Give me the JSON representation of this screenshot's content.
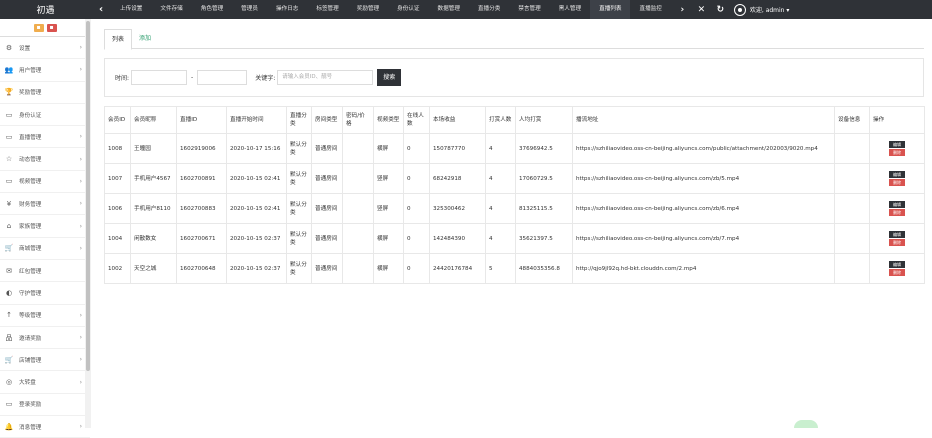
{
  "app": {
    "logo": "初遇"
  },
  "topnav": {
    "items": [
      "上传设置",
      "文件存储",
      "角色管理",
      "管理员",
      "操作日志",
      "标签管理",
      "奖励管理",
      "身份认证",
      "数据管理",
      "直播分类",
      "禁言管理",
      "黑人管理",
      "直播列表",
      "直播监控"
    ],
    "active_index": 12,
    "user_label": "欢迎, admin ▾"
  },
  "sidebar": {
    "items": [
      {
        "label": "设置",
        "icon": "gears-icon",
        "glyph": "⚙",
        "arrow": true
      },
      {
        "label": "用户管理",
        "icon": "users-icon",
        "glyph": "👥",
        "arrow": true
      },
      {
        "label": "奖励管理",
        "icon": "trophy-icon",
        "glyph": "🏆",
        "arrow": false
      },
      {
        "label": "身份认证",
        "icon": "monitor-icon",
        "glyph": "▭",
        "arrow": false
      },
      {
        "label": "直播管理",
        "icon": "monitor-icon",
        "glyph": "▭",
        "arrow": true
      },
      {
        "label": "动态管理",
        "icon": "star-icon",
        "glyph": "☆",
        "arrow": true
      },
      {
        "label": "视频管理",
        "icon": "monitor-icon",
        "glyph": "▭",
        "arrow": true
      },
      {
        "label": "财务管理",
        "icon": "yen-icon",
        "glyph": "¥",
        "arrow": true
      },
      {
        "label": "家族管理",
        "icon": "bank-icon",
        "glyph": "⌂",
        "arrow": true
      },
      {
        "label": "商城管理",
        "icon": "cart-icon",
        "glyph": "🛒",
        "arrow": true
      },
      {
        "label": "红包管理",
        "icon": "envelope-icon",
        "glyph": "✉",
        "arrow": false
      },
      {
        "label": "守护管理",
        "icon": "shield-icon",
        "glyph": "◐",
        "arrow": false
      },
      {
        "label": "等级管理",
        "icon": "level-icon",
        "glyph": "↑",
        "arrow": true
      },
      {
        "label": "邀请奖励",
        "icon": "sitemap-icon",
        "glyph": "品",
        "arrow": true
      },
      {
        "label": "店铺管理",
        "icon": "cart-icon",
        "glyph": "🛒",
        "arrow": true
      },
      {
        "label": "大转盘",
        "icon": "gamepad-icon",
        "glyph": "◎",
        "arrow": true
      },
      {
        "label": "登录奖励",
        "icon": "monitor-icon",
        "glyph": "▭",
        "arrow": false
      },
      {
        "label": "消息管理",
        "icon": "bell-icon",
        "glyph": "🔔",
        "arrow": true
      }
    ]
  },
  "tabs": {
    "list": "列表",
    "add": "添加"
  },
  "filter": {
    "time_label": "时间:",
    "dash": "-",
    "keyword_label": "关键字:",
    "keyword_placeholder": "请输入会员ID、靓号",
    "search_button": "搜索"
  },
  "table": {
    "headers": [
      "会员ID",
      "会员昵称",
      "直播ID",
      "直播开始时间",
      "直播分类",
      "房间类型",
      "密码/价格",
      "视频类型",
      "在线人数",
      "本场收益",
      "打赏人数",
      "人均打赏",
      "播流地址",
      "设备信息",
      "操作"
    ],
    "rows": [
      [
        "1008",
        "王瞳园",
        "1602919006",
        "2020-10-17 15:16",
        "默认分类",
        "普通房间",
        "",
        "横屏",
        "0",
        "150787770",
        "4",
        "37696942.5",
        "https://szhiliaovideo.oss-cn-beijing.aliyuncs.com/public/attachment/202003/9020.mp4",
        ""
      ],
      [
        "1007",
        "手机用户4567",
        "1602700891",
        "2020-10-15 02:41",
        "默认分类",
        "普通房间",
        "",
        "竖屏",
        "0",
        "68242918",
        "4",
        "17060729.5",
        "https://szhiliaovideo.oss-cn-beijing.aliyuncs.com/zb/5.mp4",
        ""
      ],
      [
        "1006",
        "手机用户8110",
        "1602700883",
        "2020-10-15 02:41",
        "默认分类",
        "普通房间",
        "",
        "竖屏",
        "0",
        "325300462",
        "4",
        "81325115.5",
        "https://szhiliaovideo.oss-cn-beijing.aliyuncs.com/zb/6.mp4",
        ""
      ],
      [
        "1004",
        "闲散数女",
        "1602700671",
        "2020-10-15 02:37",
        "默认分类",
        "普通房间",
        "",
        "横屏",
        "0",
        "142484390",
        "4",
        "35621397.5",
        "https://szhiliaovideo.oss-cn-beijing.aliyuncs.com/zb/7.mp4",
        ""
      ],
      [
        "1002",
        "天空之城",
        "1602700648",
        "2020-10-15 02:37",
        "默认分类",
        "普通房间",
        "",
        "横屏",
        "0",
        "24420176784",
        "5",
        "4884035356.8",
        "http://qjo9jl92q.hd-bkt.clouddn.com/2.mp4",
        ""
      ]
    ],
    "edit_label": "编辑",
    "delete_label": "删除"
  }
}
